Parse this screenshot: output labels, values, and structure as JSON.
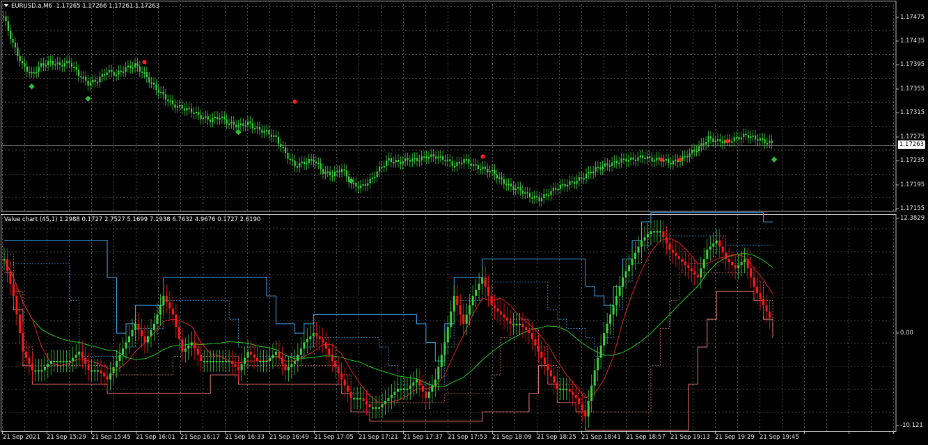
{
  "main_chart": {
    "symbol": "EURUSD.a,M6",
    "ohlc": "1.17265 1.17266 1.17261 1.17263",
    "current_price": "1.17263",
    "price_labels": [
      "1.17475",
      "1.17435",
      "1.17395",
      "1.17355",
      "1.17315",
      "1.17275",
      "1.17235",
      "1.17195",
      "1.17155"
    ]
  },
  "indicator": {
    "title": "Value chart (45,1) 1.2988 0.1727 2.7527 5.1699 7.1938 6.7632 4.9676 0.1727 2.6190",
    "scale_labels": [
      "12.3829",
      "0.00",
      "-10.121"
    ]
  },
  "time_labels": [
    "21 Sep 2021",
    "21 Sep 15:29",
    "21 Sep 15:45",
    "21 Sep 16:01",
    "21 Sep 16:17",
    "21 Sep 16:33",
    "21 Sep 16:49",
    "21 Sep 17:05",
    "21 Sep 17:21",
    "21 Sep 17:37",
    "21 Sep 17:53",
    "21 Sep 18:09",
    "21 Sep 18:25",
    "21 Sep 18:41",
    "21 Sep 18:57",
    "21 Sep 19:13",
    "21 Sep 19:29",
    "21 Sep 19:45"
  ],
  "colors": {
    "background": "#000000",
    "grid": "#8a8a8a",
    "bull": "#3ed23e",
    "bear": "#ff1a1a",
    "band_upper": "#3aa6ee",
    "band_lower": "#e87a7a",
    "signal_green": "#2fbf3a",
    "signal_red": "#ff2020",
    "ma_green": "#22cc22",
    "ma_red": "#dd2222"
  },
  "chart_data": [
    {
      "type": "line",
      "title": "EURUSD.a,M6",
      "ylim": [
        1.17155,
        1.17495
      ],
      "x_start": "21 Sep 2021",
      "series": [
        {
          "values": [
            1.17475,
            1.1743,
            1.17395,
            1.1738,
            1.17395,
            1.174,
            1.17395,
            1.174,
            1.1738,
            1.17365,
            1.1737,
            1.17385,
            1.1738,
            1.1739,
            1.17395,
            1.1738,
            1.1736,
            1.17345,
            1.1733,
            1.17325,
            1.1732,
            1.1731,
            1.17305,
            1.1731,
            1.173,
            1.17295,
            1.173,
            1.1729,
            1.17285,
            1.17275,
            1.1725,
            1.1723,
            1.17235,
            1.1724,
            1.1722,
            1.17215,
            1.17225,
            1.172,
            1.17195,
            1.17205,
            1.17225,
            1.1724,
            1.17235,
            1.1724,
            1.1724,
            1.17245,
            1.17245,
            1.1724,
            1.1723,
            1.1724,
            1.1723,
            1.17225,
            1.1722,
            1.17205,
            1.17195,
            1.1719,
            1.1718,
            1.17175,
            1.17185,
            1.17195,
            1.172,
            1.17205,
            1.17215,
            1.17225,
            1.1723,
            1.17235,
            1.1724,
            1.1724,
            1.17245,
            1.1724,
            1.1724,
            1.17235,
            1.1724,
            1.1725,
            1.1726,
            1.17275,
            1.1727,
            1.1727,
            1.17275,
            1.1728,
            1.17275,
            1.1727,
            1.17265
          ]
        }
      ],
      "markers_green": [
        [
          1.1736,
          3
        ],
        [
          1.1734,
          9
        ],
        [
          1.17285,
          25
        ],
        [
          1.17205,
          37
        ],
        [
          1.1724,
          82
        ]
      ],
      "markers_red": [
        [
          1.174,
          15
        ],
        [
          1.17335,
          31
        ],
        [
          1.17245,
          51
        ],
        [
          1.1724,
          70
        ],
        [
          1.1724,
          72
        ],
        [
          1.1727,
          77
        ]
      ]
    },
    {
      "type": "bar",
      "title": "Value chart (45,1)",
      "ylim": [
        -10.121,
        12.3829
      ],
      "values": [
        8,
        4,
        -2,
        -4,
        -4,
        -3,
        -3,
        -3,
        -2,
        -4,
        -4,
        -5,
        -3,
        -1,
        1,
        -1,
        1,
        4,
        2,
        -2,
        -1,
        -3,
        -3,
        -3,
        -3,
        -4,
        -2,
        -3,
        -3,
        -2,
        -4,
        -3,
        -1,
        0,
        -1,
        -3,
        -5,
        -7,
        -7,
        -8,
        -8,
        -7,
        -6,
        -6,
        -5,
        -7,
        -5,
        -1,
        4,
        1,
        4,
        6,
        3,
        2,
        1,
        1,
        0,
        -2,
        -4,
        -6,
        -6,
        -7,
        -9,
        -4,
        0,
        3,
        6,
        8,
        10,
        11,
        11,
        9,
        8,
        7,
        6,
        9,
        10,
        8,
        7,
        8,
        5,
        3,
        1
      ]
    }
  ]
}
